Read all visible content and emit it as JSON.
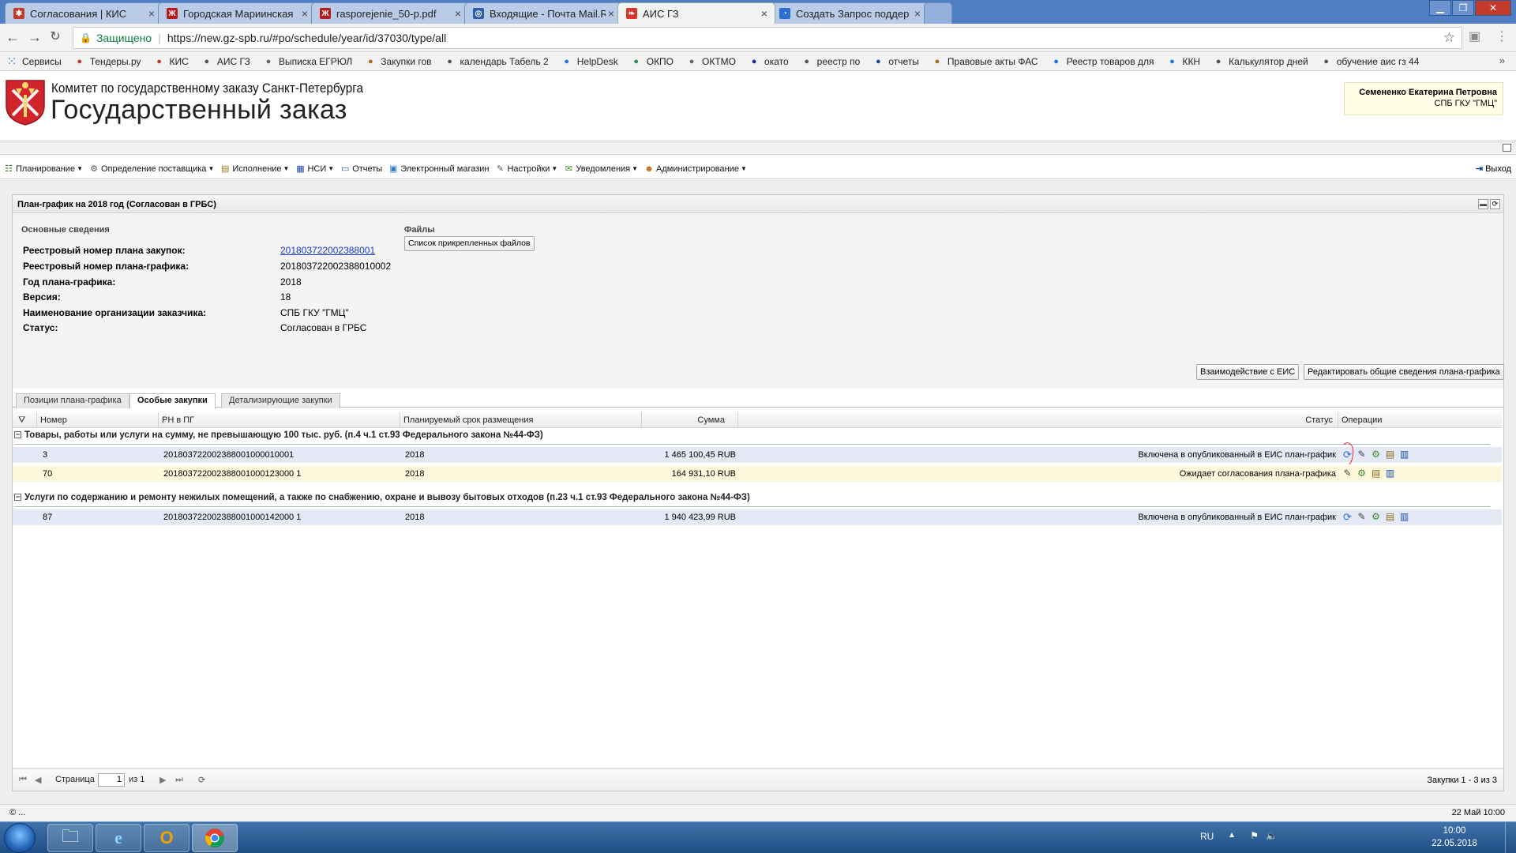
{
  "browser": {
    "tabs": [
      {
        "title": "Согласования | КИС",
        "color": "#c0392b",
        "glyph": "✱",
        "active": false
      },
      {
        "title": "Городская Мариинская",
        "color": "#b51d1d",
        "glyph": "Ж",
        "active": false
      },
      {
        "title": "rasporejenie_50-p.pdf",
        "color": "#b51d1d",
        "glyph": "Ж",
        "active": false
      },
      {
        "title": "Входящие - Почта Mail.R",
        "color": "#2d5fa7",
        "glyph": "◎",
        "active": false
      },
      {
        "title": "АИС ГЗ",
        "color": "#d7372b",
        "glyph": "❧",
        "active": true
      },
      {
        "title": "Создать Запрос поддер",
        "color": "#2b6fd1",
        "glyph": "◔",
        "active": false
      }
    ],
    "secure_label": "Защищено",
    "url": "https://new.gz-spb.ru/#po/schedule/year/id/37030/type/all",
    "bookmarks": [
      {
        "label": "Сервисы",
        "icon": "apps-icon",
        "color": "#4285f4"
      },
      {
        "label": "Тендеры.ру",
        "icon": "tender-icon",
        "color": "#c0392b"
      },
      {
        "label": "КИС",
        "icon": "kis-icon",
        "color": "#c0392b"
      },
      {
        "label": "АИС ГЗ",
        "icon": "aisgz-icon",
        "color": "#555"
      },
      {
        "label": "Выписка ЕГРЮЛ",
        "icon": "egrul-icon",
        "color": "#666"
      },
      {
        "label": "Закупки гов",
        "icon": "zakupki-icon",
        "color": "#a07020"
      },
      {
        "label": "календарь Табель 2",
        "icon": "calendar-icon",
        "color": "#555"
      },
      {
        "label": "HelpDesk",
        "icon": "helpdesk-icon",
        "color": "#1a73e8"
      },
      {
        "label": "ОКПО",
        "icon": "okpo-icon",
        "color": "#2e8b57"
      },
      {
        "label": "ОКТМО",
        "icon": "oktmo-icon",
        "color": "#666"
      },
      {
        "label": "окато",
        "icon": "okato-icon",
        "color": "#1a2a9a"
      },
      {
        "label": "реестр по",
        "icon": "reestr-icon",
        "color": "#555"
      },
      {
        "label": "отчеты",
        "icon": "reports-icon",
        "color": "#1a4aa0"
      },
      {
        "label": "Правовые акты ФАС",
        "icon": "fas-icon",
        "color": "#a07020"
      },
      {
        "label": "Реестр товаров для",
        "icon": "registry-icon",
        "color": "#1a73e8"
      },
      {
        "label": "ККН",
        "icon": "kkn-icon",
        "color": "#1a73e8"
      },
      {
        "label": "Калькулятор дней",
        "icon": "calculator-icon",
        "color": "#555"
      },
      {
        "label": "обучение аис гз 44",
        "icon": "training-icon",
        "color": "#555"
      }
    ],
    "bookmarks_more": "»"
  },
  "site": {
    "org_name": "Комитет по государственному заказу Санкт-Петербурга",
    "title": "Государственный заказ",
    "user_name": "Семененко Екатерина Петровна",
    "user_org": "СПБ ГКУ \"ГМЦ\""
  },
  "menu": {
    "items": [
      {
        "label": "Планирование",
        "icon": "planning-icon",
        "dropdown": true
      },
      {
        "label": "Определение поставщика",
        "icon": "supplier-icon",
        "dropdown": true
      },
      {
        "label": "Исполнение",
        "icon": "execution-icon",
        "dropdown": true
      },
      {
        "label": "НСИ",
        "icon": "nsi-icon",
        "dropdown": true
      },
      {
        "label": "Отчеты",
        "icon": "reports-icon",
        "dropdown": false
      },
      {
        "label": "Электронный магазин",
        "icon": "shop-icon",
        "dropdown": false
      },
      {
        "label": "Настройки",
        "icon": "settings-icon",
        "dropdown": true
      },
      {
        "label": "Уведомления",
        "icon": "notifications-icon",
        "dropdown": true
      },
      {
        "label": "Администрирование",
        "icon": "admin-icon",
        "dropdown": true
      }
    ],
    "exit_label": "Выход"
  },
  "panel": {
    "title": "План-график на 2018 год (Согласован в ГРБС)",
    "section_label": "Основные сведения",
    "files_label": "Файлы",
    "files_button": "Список прикрепленных файлов",
    "fields": [
      {
        "label": "Реестровый номер плана закупок:",
        "value": "201803722002388001",
        "link": true
      },
      {
        "label": "Реестровый номер плана-графика:",
        "value": "201803722002388010002",
        "link": false
      },
      {
        "label": "Год плана-графика:",
        "value": "2018",
        "link": false
      },
      {
        "label": "Версия:",
        "value": "18",
        "link": false
      },
      {
        "label": "Наименование организации заказчика:",
        "value": "СПБ ГКУ \"ГМЦ\"",
        "link": false
      },
      {
        "label": "Статус:",
        "value": "Согласован в ГРБС",
        "link": false
      }
    ],
    "btn_eis": "Взаимодействие с ЕИС",
    "btn_edit": "Редактировать общие сведения плана-графика",
    "tabs": [
      "Позиции плана-графика",
      "Особые закупки",
      "Детализирующие закупки"
    ],
    "active_tab": 1,
    "columns": {
      "number": "Номер",
      "rn": "РН в ПГ",
      "term": "Планируемый срок размещения",
      "sum": "Сумма",
      "status": "Статус",
      "ops": "Операции"
    },
    "groups": [
      {
        "title": "Товары, работы или услуги на сумму, не превышающую 100 тыс. руб. (п.4 ч.1 ст.93 Федерального закона №44-ФЗ)",
        "rows": [
          {
            "number": "3",
            "rn": "201803722002388001000010001",
            "term": "2018",
            "sum": "1 465 100,45 RUB",
            "status": "Включена в опубликованный в ЕИС план-график",
            "ops": [
              "refresh",
              "edit",
              "gears",
              "doc",
              "chart"
            ]
          },
          {
            "number": "70",
            "rn": "201803722002388001000123000 1",
            "term": "2018",
            "sum": "164 931,10 RUB",
            "status": "Ожидает согласования плана-графика",
            "ops": [
              "edit",
              "gears",
              "doc",
              "chart"
            ]
          }
        ]
      },
      {
        "title": "Услуги по содержанию и ремонту нежилых помещений, а также по снабжению, охране и вывозу бытовых отходов (п.23 ч.1 ст.93 Федерального закона №44-ФЗ)",
        "rows": [
          {
            "number": "87",
            "rn": "201803722002388001000142000 1",
            "term": "2018",
            "sum": "1 940 423,99 RUB",
            "status": "Включена в опубликованный в ЕИС план-график",
            "ops": [
              "refresh",
              "edit",
              "gears",
              "doc",
              "chart"
            ]
          }
        ]
      }
    ],
    "pager": {
      "page_label": "Страница",
      "page": "1",
      "of_label": "из 1",
      "count": "Закупки 1 - 3 из 3"
    }
  },
  "statusbar": {
    "left": "© ...",
    "right": "22 Май 10:00"
  },
  "taskbar": {
    "lang": "RU",
    "time": "10:00",
    "date": "22.05.2018"
  }
}
